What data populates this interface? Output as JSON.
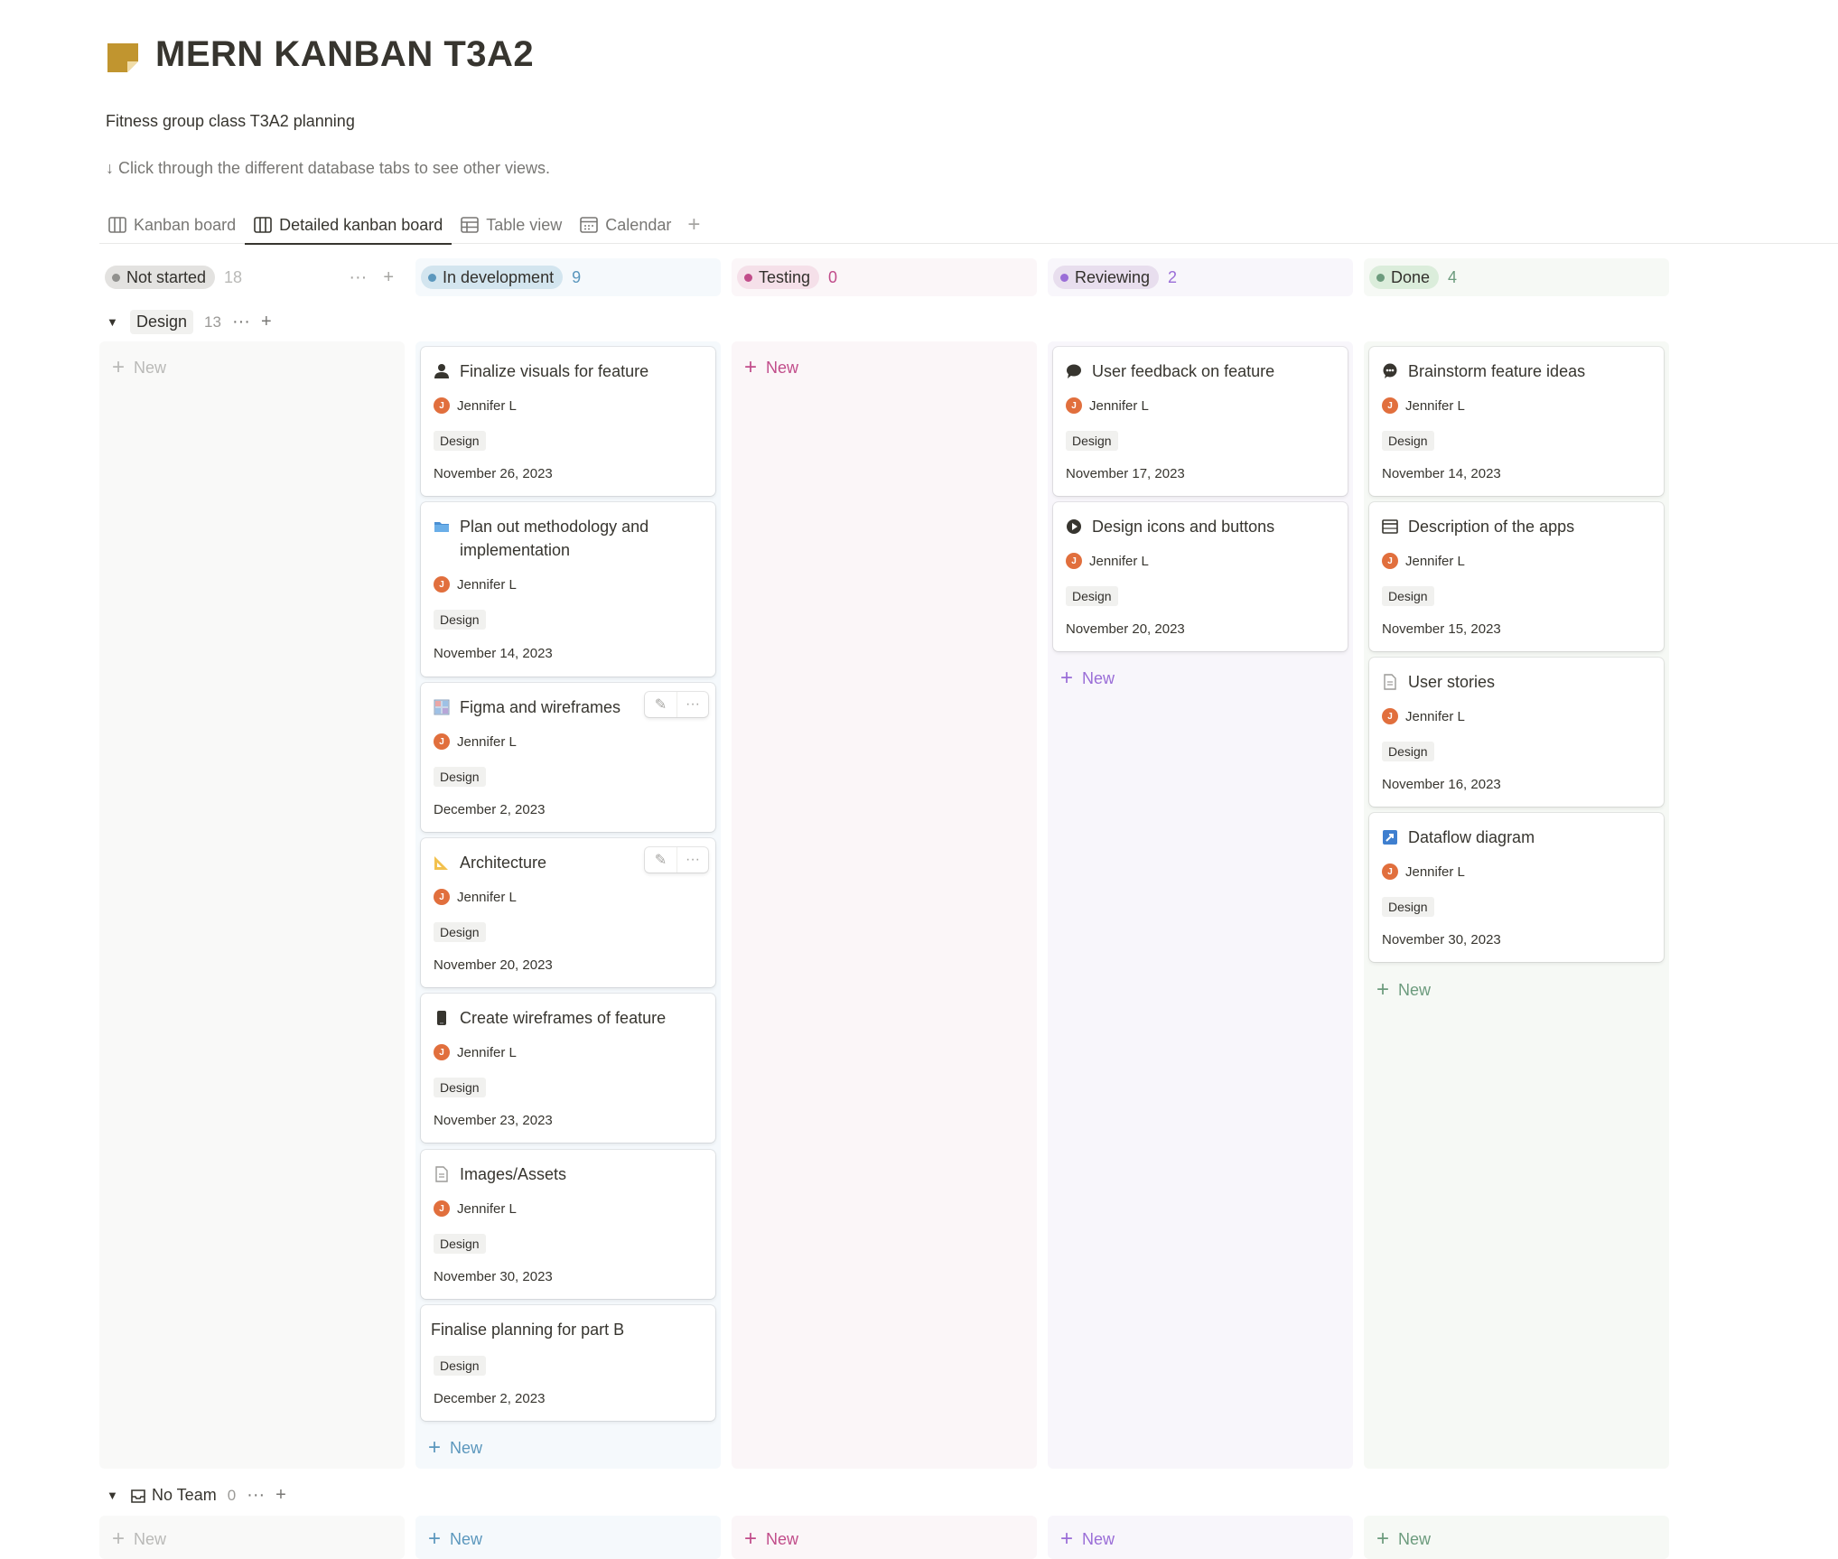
{
  "page": {
    "title": "MERN KANBAN T3A2",
    "description": "Fitness group class T3A2 planning",
    "hint": "↓ Click through the different database tabs to see other views.",
    "icon": "sticky-note-icon",
    "icon_color": "#c1952f"
  },
  "tabs": [
    {
      "label": "Kanban board",
      "icon": "board-icon"
    },
    {
      "label": "Detailed kanban board",
      "icon": "board-icon",
      "active": true
    },
    {
      "label": "Table view",
      "icon": "table-icon"
    },
    {
      "label": "Calendar",
      "icon": "calendar-icon"
    }
  ],
  "columns": [
    {
      "label": "Not started",
      "count": "18",
      "pill_bg": "#e3e2e0",
      "dot": "#91918e",
      "bg": "#f9f9f8",
      "count_color": "#b9b9b7",
      "new_color": "#b9b9b7"
    },
    {
      "label": "In development",
      "count": "9",
      "pill_bg": "#d3e5ef",
      "dot": "#5b97bd",
      "bg": "#f5f9fc",
      "count_color": "#5b97bd",
      "new_color": "#5b97bd"
    },
    {
      "label": "Testing",
      "count": "0",
      "pill_bg": "#f5e0e9",
      "dot": "#c14c8a",
      "bg": "#fbf6f8",
      "count_color": "#c14c8a",
      "new_color": "#c14c8a"
    },
    {
      "label": "Reviewing",
      "count": "2",
      "pill_bg": "#e8deee",
      "dot": "#9a6dd7",
      "bg": "#f8f6fb",
      "count_color": "#9a6dd7",
      "new_color": "#9a6dd7"
    },
    {
      "label": "Done",
      "count": "4",
      "pill_bg": "#dbeddb",
      "dot": "#6c9b7d",
      "bg": "#f6f9f5",
      "count_color": "#6c9b7d",
      "new_color": "#6c9b7d"
    }
  ],
  "groups": {
    "design": {
      "label": "Design",
      "count": "13"
    },
    "no_team": {
      "label": "No Team",
      "count": "0"
    }
  },
  "new_label": "New",
  "cards": {
    "in_development": [
      {
        "title": "Finalize visuals for feature",
        "icon": "person-icon",
        "person": "Jennifer L",
        "initial": "J",
        "tag": "Design",
        "date": "November 26, 2023"
      },
      {
        "title": "Plan out methodology and implementation",
        "icon": "folder-icon",
        "person": "Jennifer L",
        "initial": "J",
        "tag": "Design",
        "date": "November 14, 2023"
      },
      {
        "title": "Figma and wireframes",
        "icon": "grid-image-icon",
        "person": "Jennifer L",
        "initial": "J",
        "tag": "Design",
        "date": "December 2, 2023"
      },
      {
        "title": "Architecture",
        "icon": "triangle-ruler-icon",
        "person": "Jennifer L",
        "initial": "J",
        "tag": "Design",
        "date": "November 20, 2023"
      },
      {
        "title": "Create wireframes of feature",
        "icon": "mobile-phone-icon",
        "person": "Jennifer L",
        "initial": "J",
        "tag": "Design",
        "date": "November 23, 2023"
      },
      {
        "title": "Images/Assets",
        "icon": "document-icon",
        "person": "Jennifer L",
        "initial": "J",
        "tag": "Design",
        "date": "November 30, 2023"
      },
      {
        "title": "Finalise planning for part B",
        "tag": "Design",
        "date": "December 2, 2023"
      }
    ],
    "reviewing": [
      {
        "title": "User feedback on feature",
        "icon": "speech-bubble-icon",
        "person": "Jennifer L",
        "initial": "J",
        "tag": "Design",
        "date": "November 17, 2023"
      },
      {
        "title": "Design icons and buttons",
        "icon": "play-circle-icon",
        "person": "Jennifer L",
        "initial": "J",
        "tag": "Design",
        "date": "November 20, 2023"
      }
    ],
    "done": [
      {
        "title": "Brainstorm feature ideas",
        "icon": "thought-bubble-icon",
        "person": "Jennifer L",
        "initial": "J",
        "tag": "Design",
        "date": "November 14, 2023"
      },
      {
        "title": "Description of the apps",
        "icon": "window-icon",
        "person": "Jennifer L",
        "initial": "J",
        "tag": "Design",
        "date": "November 15, 2023"
      },
      {
        "title": "User stories",
        "icon": "document-icon",
        "person": "Jennifer L",
        "initial": "J",
        "tag": "Design",
        "date": "November 16, 2023"
      },
      {
        "title": "Dataflow diagram",
        "icon": "arrow-square-icon",
        "person": "Jennifer L",
        "initial": "J",
        "tag": "Design",
        "date": "November 30, 2023"
      }
    ]
  }
}
